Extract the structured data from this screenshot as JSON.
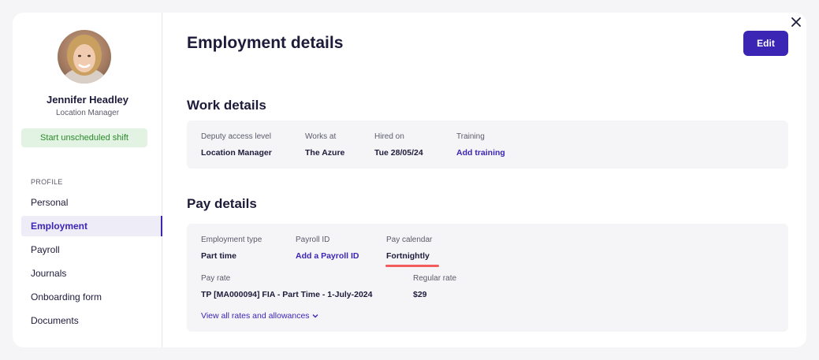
{
  "user": {
    "name": "Jennifer Headley",
    "role": "Location Manager",
    "shift_button": "Start unscheduled shift"
  },
  "sidebar": {
    "section_label": "PROFILE",
    "items": [
      {
        "label": "Personal",
        "active": false
      },
      {
        "label": "Employment",
        "active": true
      },
      {
        "label": "Payroll",
        "active": false
      },
      {
        "label": "Journals",
        "active": false
      },
      {
        "label": "Onboarding form",
        "active": false
      },
      {
        "label": "Documents",
        "active": false
      }
    ]
  },
  "header": {
    "title": "Employment details",
    "edit_label": "Edit"
  },
  "work": {
    "title": "Work details",
    "access_label": "Deputy access level",
    "access_value": "Location Manager",
    "works_at_label": "Works at",
    "works_at_value": "The Azure",
    "hired_label": "Hired on",
    "hired_value": "Tue 28/05/24",
    "training_label": "Training",
    "training_link": "Add training"
  },
  "pay": {
    "title": "Pay details",
    "type_label": "Employment type",
    "type_value": "Part time",
    "payroll_id_label": "Payroll ID",
    "payroll_id_link": "Add a Payroll ID",
    "calendar_label": "Pay calendar",
    "calendar_value": "Fortnightly",
    "rate_label": "Pay rate",
    "rate_value": "TP [MA000094] FIA - Part Time - 1-July-2024",
    "regular_label": "Regular rate",
    "regular_value": "$29",
    "rates_link": "View all rates and allowances"
  },
  "colors": {
    "accent": "#3b25b5",
    "success_bg": "#e3f3e3",
    "success_text": "#2b8a2b",
    "highlight": "#f25c5c"
  }
}
